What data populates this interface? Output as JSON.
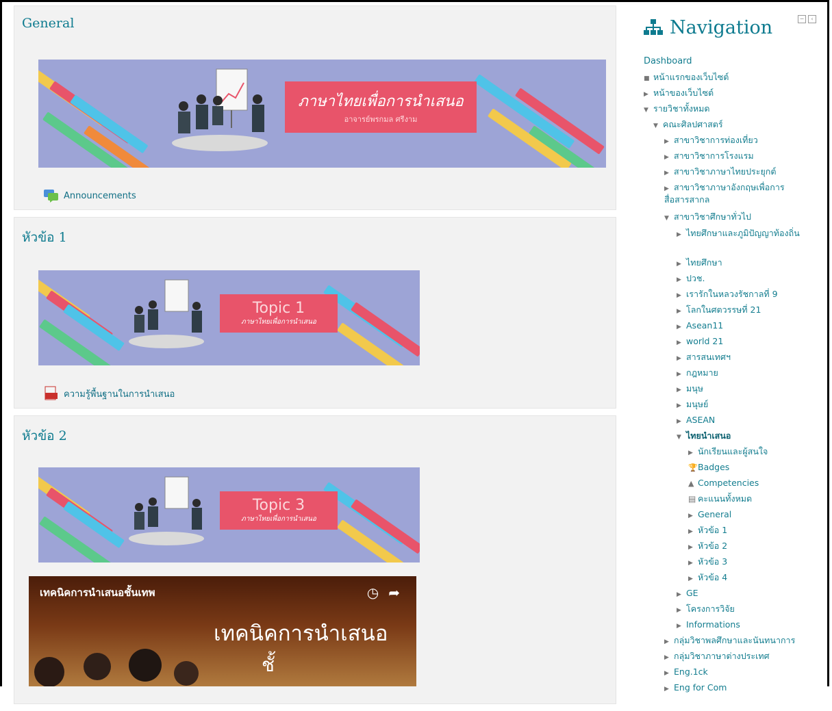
{
  "sections": [
    {
      "title": "General",
      "banner_line1": "ภาษาไทยเพื่อการนำเสนอ",
      "banner_line2": "อาจารย์พรกมล ศรีงาม",
      "activity": "Announcements",
      "activity_icon": "forum-icon"
    },
    {
      "title": "หัวข้อ 1",
      "banner_line1": "Topic 1",
      "banner_line2": "ภาษาไทยเพื่อการนำเสนอ",
      "activity": "ความรู้พื้นฐานในการนำเสนอ",
      "activity_icon": "pdf-icon"
    },
    {
      "title": "หัวข้อ 2",
      "banner_line1": "Topic 3",
      "banner_line2": "ภาษาไทยเพื่อการนำเสนอ"
    }
  ],
  "video": {
    "title": "เทคนิคการนำเสนอชั้นเทพ",
    "overlay": "เทคนิคการนำเสนอ",
    "overlay_line2": "ชั้"
  },
  "navigation": {
    "title": "Navigation",
    "dashboard": "Dashboard",
    "items": [
      {
        "label": "หน้าแรกของเว็บไซต์",
        "kind": "bullet"
      },
      {
        "label": "หน้าของเว็บไซต์",
        "kind": "collapsed"
      },
      {
        "label": "รายวิชาทั้งหมด",
        "kind": "expanded"
      },
      {
        "label": "คณะศิลปศาสตร์",
        "kind": "expanded"
      },
      {
        "label": "สาขาวิชาการท่องเที่ยว",
        "kind": "collapsed"
      },
      {
        "label": "สาขาวิชาการโรงแรม",
        "kind": "collapsed"
      },
      {
        "label": "สาขาวิชาภาษาไทยประยุกต์",
        "kind": "collapsed"
      },
      {
        "label": "สาขาวิชาภาษาอังกฤษเพื่อการสื่อสารสากล",
        "kind": "collapsed"
      },
      {
        "label": "สาขาวิชาศึกษาทั่วไป",
        "kind": "expanded"
      },
      {
        "label": "ไทยศึกษาและภูมิปัญญาท้องถิ่น",
        "kind": "collapsed"
      },
      {
        "label": "ไทยศึกษา",
        "kind": "collapsed"
      },
      {
        "label": "ปวช.",
        "kind": "collapsed"
      },
      {
        "label": "เรารักในหลวงรัชกาลที่ 9",
        "kind": "collapsed"
      },
      {
        "label": "โลกในศตวรรษที่ 21",
        "kind": "collapsed"
      },
      {
        "label": "Asean11",
        "kind": "collapsed"
      },
      {
        "label": "world 21",
        "kind": "collapsed"
      },
      {
        "label": "สารสนเทศฯ",
        "kind": "collapsed"
      },
      {
        "label": "กฎหมาย",
        "kind": "collapsed"
      },
      {
        "label": "มนุษ",
        "kind": "collapsed"
      },
      {
        "label": "มนุษย์",
        "kind": "collapsed"
      },
      {
        "label": "ASEAN",
        "kind": "collapsed"
      },
      {
        "label": "ไทยนำเสนอ",
        "kind": "expanded-current"
      },
      {
        "label": "นักเรียนและผู้สนใจ",
        "kind": "collapsed"
      },
      {
        "label": "Badges",
        "kind": "badge-icon"
      },
      {
        "label": "Competencies",
        "kind": "competency-icon"
      },
      {
        "label": "คะแนนทั้งหมด",
        "kind": "grades-icon"
      },
      {
        "label": "General",
        "kind": "collapsed"
      },
      {
        "label": "หัวข้อ 1",
        "kind": "collapsed"
      },
      {
        "label": "หัวข้อ 2",
        "kind": "collapsed"
      },
      {
        "label": "หัวข้อ 3",
        "kind": "collapsed"
      },
      {
        "label": "หัวข้อ 4",
        "kind": "collapsed"
      },
      {
        "label": "GE",
        "kind": "collapsed"
      },
      {
        "label": "โครงการวิจัย",
        "kind": "collapsed"
      },
      {
        "label": "Informations",
        "kind": "collapsed"
      },
      {
        "label": "กลุ่มวิชาพลศึกษาและนันทนาการ",
        "kind": "collapsed"
      },
      {
        "label": "กลุ่มวิชาภาษาต่างประเทศ",
        "kind": "collapsed"
      },
      {
        "label": "Eng.1ck",
        "kind": "collapsed"
      },
      {
        "label": "Eng for Com",
        "kind": "collapsed"
      }
    ]
  },
  "colors": {
    "accent": "#0e7b8f",
    "banner_bg": "#9da4d6",
    "banner_box": "#e8546a"
  }
}
